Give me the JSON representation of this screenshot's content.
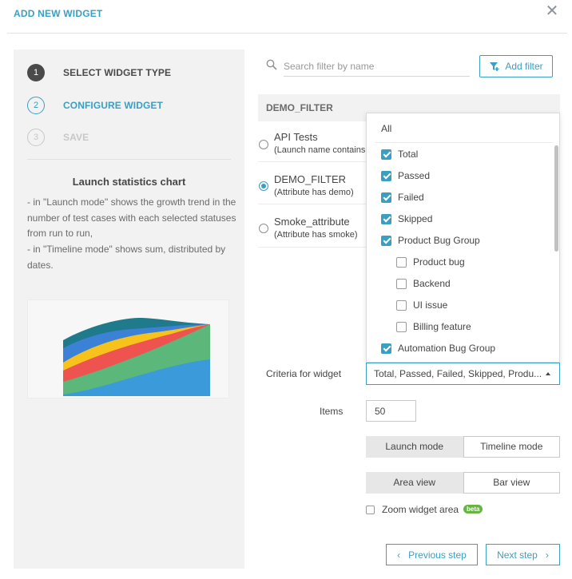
{
  "modal": {
    "title": "ADD NEW WIDGET",
    "close_icon": "close-icon"
  },
  "steps": [
    {
      "number": "1",
      "label": "SELECT WIDGET TYPE",
      "state": "done"
    },
    {
      "number": "2",
      "label": "CONFIGURE WIDGET",
      "state": "active"
    },
    {
      "number": "3",
      "label": "SAVE",
      "state": "pending"
    }
  ],
  "widget": {
    "name": "Launch statistics chart",
    "description": "- in \"Launch mode\" shows the growth trend in the number of test cases with each selected statuses from run to run,\n- in \"Timeline mode\" shows sum, distributed by dates."
  },
  "search": {
    "placeholder": "Search filter by name",
    "value": ""
  },
  "add_filter": {
    "label": "Add filter",
    "icon": "filter-plus-icon"
  },
  "filter_group": "DEMO_FILTER",
  "filters": [
    {
      "name": "API Tests",
      "sub": "(Launch name contains API)",
      "checked": false
    },
    {
      "name": "DEMO_FILTER",
      "sub": "(Attribute has demo)",
      "checked": true
    },
    {
      "name": "Smoke_attribute",
      "sub": "(Attribute has smoke)",
      "checked": false
    }
  ],
  "dropdown": {
    "all_label": "All",
    "options": [
      {
        "label": "Total",
        "checked": true,
        "indent": false
      },
      {
        "label": "Passed",
        "checked": true,
        "indent": false
      },
      {
        "label": "Failed",
        "checked": true,
        "indent": false
      },
      {
        "label": "Skipped",
        "checked": true,
        "indent": false
      },
      {
        "label": "Product Bug Group",
        "checked": true,
        "indent": false
      },
      {
        "label": "Product bug",
        "checked": false,
        "indent": true
      },
      {
        "label": "Backend",
        "checked": false,
        "indent": true
      },
      {
        "label": "UI issue",
        "checked": false,
        "indent": true
      },
      {
        "label": "Billing feature",
        "checked": false,
        "indent": true
      },
      {
        "label": "Automation Bug Group",
        "checked": true,
        "indent": false
      }
    ]
  },
  "criteria": {
    "label": "Criteria for widget",
    "value": "Total, Passed, Failed, Skipped, Produ..."
  },
  "items": {
    "label": "Items",
    "value": "50"
  },
  "mode_toggle": {
    "options": [
      "Launch mode",
      "Timeline mode"
    ],
    "selected": "Launch mode"
  },
  "view_toggle": {
    "options": [
      "Area view",
      "Bar view"
    ],
    "selected": "Area view"
  },
  "zoom": {
    "label": "Zoom widget area",
    "badge": "beta",
    "checked": false
  },
  "nav": {
    "prev_label": "Previous step",
    "next_label": "Next step"
  },
  "colors": {
    "accent": "#3b9fc3",
    "beta": "#66b543",
    "chart_total": "#1f7a8c",
    "chart_blue": "#3b82d6",
    "chart_yellow": "#f7c21b",
    "chart_red": "#ef5350",
    "chart_green": "#5cb77a",
    "chart_lightblue": "#3b9ad9"
  }
}
